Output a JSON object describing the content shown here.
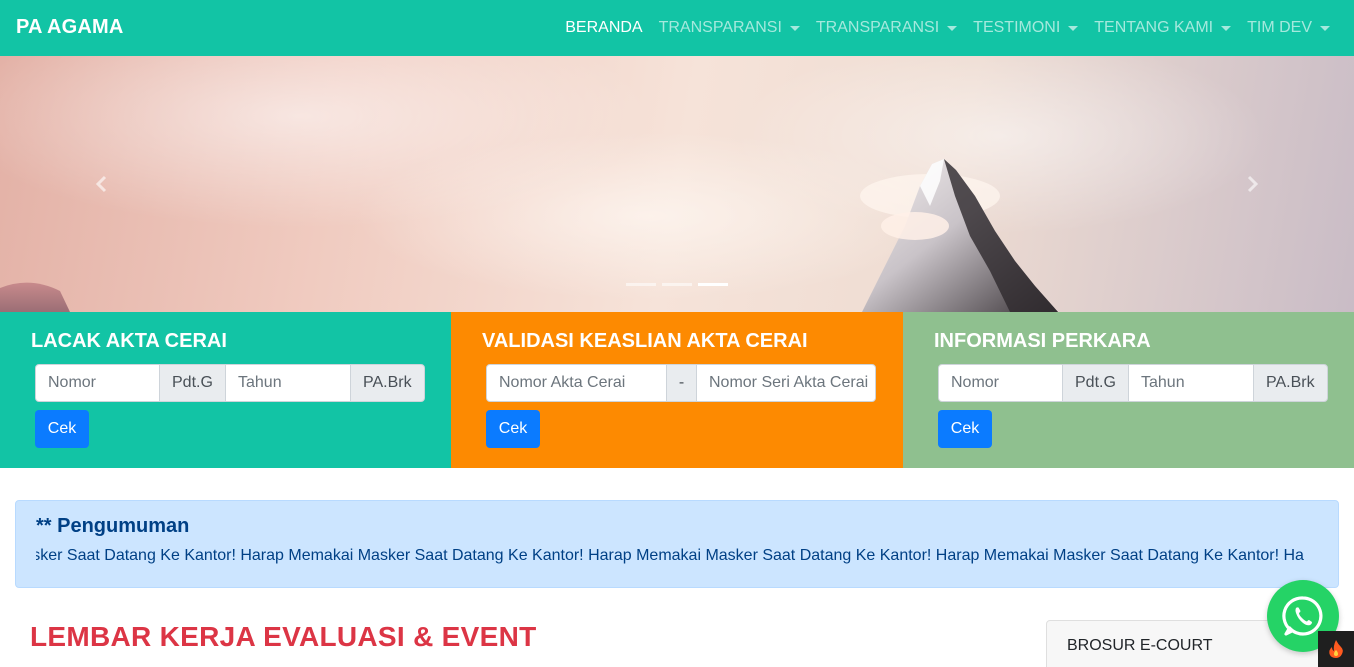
{
  "navbar": {
    "brand": "PA AGAMA",
    "items": [
      {
        "label": "BERANDA",
        "active": true,
        "dropdown": false
      },
      {
        "label": "TRANSPARANSI",
        "active": false,
        "dropdown": true
      },
      {
        "label": "TRANSPARANSI",
        "active": false,
        "dropdown": true
      },
      {
        "label": "TESTIMONI",
        "active": false,
        "dropdown": true
      },
      {
        "label": "TENTANG KAMI",
        "active": false,
        "dropdown": true
      },
      {
        "label": "TIM DEV",
        "active": false,
        "dropdown": true
      }
    ]
  },
  "carousel": {
    "slides": 3,
    "active_slide": 3,
    "prev_label": "Previous",
    "next_label": "Next"
  },
  "panels": {
    "lacak": {
      "title": "LACAK AKTA CERAI",
      "nomor_placeholder": "Nomor",
      "addon_1": "Pdt.G",
      "tahun_placeholder": "Tahun",
      "addon_2": "PA.Brk",
      "button": "Cek",
      "color": "#12c4a5"
    },
    "validasi": {
      "title": "VALIDASI KEASLIAN AKTA CERAI",
      "nomor_akta_placeholder": "Nomor Akta Cerai",
      "separator": "-",
      "nomor_seri_placeholder": "Nomor Seri Akta Cerai",
      "button": "Cek",
      "color": "#fd8a01"
    },
    "perkara": {
      "title": "INFORMASI PERKARA",
      "nomor_placeholder": "Nomor",
      "addon_1": "Pdt.G",
      "tahun_placeholder": "Tahun",
      "addon_2": "PA.Brk",
      "button": "Cek",
      "color": "#8fc08f"
    }
  },
  "announcement": {
    "title": "** Pengumuman",
    "text": "Masker Saat Datang Ke Kantor! Harap Memakai Masker Saat Datang Ke Kantor! Harap Memakai Masker Saat Datang Ke Kantor! Harap Memakai Masker Saat Datang Ke Kantor! Ha"
  },
  "main": {
    "section_title": "LEMBAR KERJA EVALUASI & EVENT"
  },
  "sidebar": {
    "card_title": "BROSUR E-COURT"
  },
  "floating": {
    "whatsapp_icon": "whatsapp-icon",
    "fire_icon": "fire-icon"
  },
  "colors": {
    "primary": "#12c4a5",
    "orange": "#fd8a01",
    "green": "#8fc08f",
    "button_blue": "#0b7bff",
    "danger": "#dc3545",
    "alert_bg": "#cce5ff"
  }
}
